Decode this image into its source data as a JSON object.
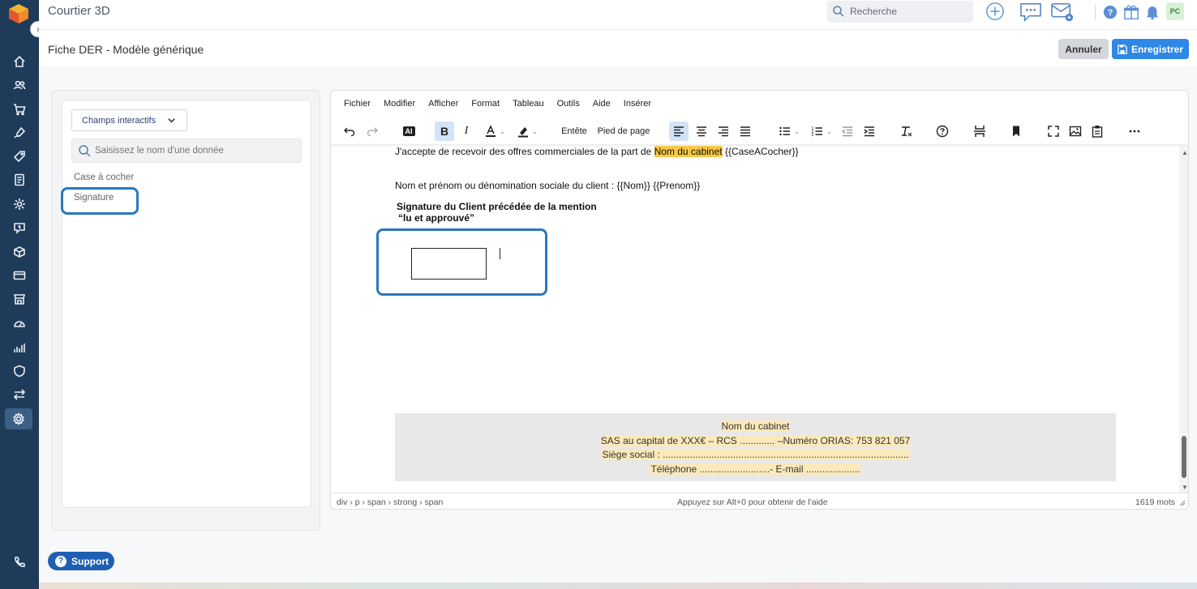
{
  "app": {
    "title": "Courtier 3D"
  },
  "header": {
    "search_placeholder": "Recherche",
    "user_initials": "PC"
  },
  "subheader": {
    "title": "Fiche DER - Modèle générique",
    "cancel_label": "Annuler",
    "save_label": "Enregistrer"
  },
  "left_panel": {
    "dropdown_label": "Champs interactifs",
    "search_placeholder": "Saisissez le nom d'une donnée",
    "items": [
      {
        "label": "Case à cocher"
      },
      {
        "label": "Signature"
      }
    ]
  },
  "editor": {
    "menu": [
      "Fichier",
      "Modifier",
      "Afficher",
      "Format",
      "Tableau",
      "Outils",
      "Aide",
      "Insérer"
    ],
    "toolbar": {
      "ai_label": "AI",
      "header_label": "Entête",
      "footer_label": "Pied de page"
    },
    "content": {
      "line1_prefix": "J'accepte de recevoir des offres commerciales de la part de ",
      "line1_highlight": "Nom du cabinet",
      "line1_suffix": " {{CaseACocher}}",
      "line2": "Nom et prénom ou dénomination sociale du client : {{Nom}} {{Prenom}}",
      "signature_title": "Signature du Client précédée de la mention",
      "signature_mention": "“lu et approuvé”"
    },
    "footer": {
      "line1": "Nom du cabinet",
      "line2": "SAS au capital de XXX€ – RCS ............. –Numéro ORIAS: 753 821 057",
      "line3": "Siège social : ...........................................................................................",
      "line4": "Téléphone ..........................- E-mail ...................."
    },
    "status": {
      "path": "div › p › span › strong › span",
      "help": "Appuyez sur Alt+0 pour obtenir de l'aide",
      "words": "1619 mots"
    }
  },
  "support": {
    "label": "Support"
  },
  "colors": {
    "rail": "#1f3b5a",
    "accent": "#2f87e6",
    "highlight_border": "#2a78c0",
    "mark": "#f6c945"
  }
}
